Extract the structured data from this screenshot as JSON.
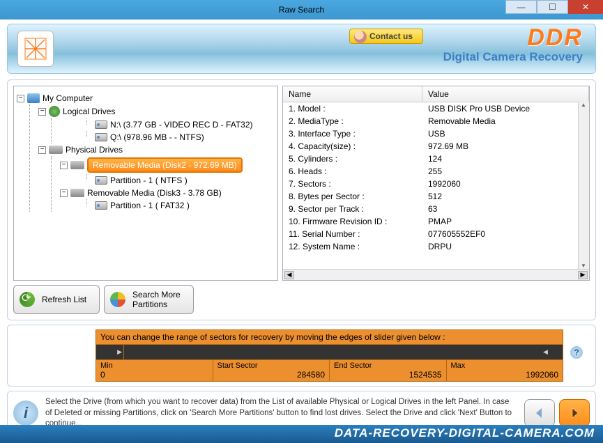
{
  "window": {
    "title": "Raw Search"
  },
  "header": {
    "contact_label": "Contact us",
    "brand_main": "DDR",
    "brand_sub": "Digital Camera Recovery"
  },
  "tree": {
    "root": "My Computer",
    "logical_label": "Logical Drives",
    "logical_drives": [
      "N:\\ (3.77 GB - VIDEO REC D - FAT32)",
      "Q:\\ (978.96 MB -  - NTFS)"
    ],
    "physical_label": "Physical Drives",
    "physical": [
      {
        "label": "Removable Media (Disk2 - 972.69 MB)",
        "selected": true,
        "partitions": [
          "Partition - 1 ( NTFS )"
        ]
      },
      {
        "label": "Removable Media (Disk3 - 3.78 GB)",
        "selected": false,
        "partitions": [
          "Partition - 1 ( FAT32 )"
        ]
      }
    ]
  },
  "props": {
    "col_name": "Name",
    "col_value": "Value",
    "rows": [
      {
        "n": "1. Model :",
        "v": "USB DISK Pro USB Device"
      },
      {
        "n": "2. MediaType :",
        "v": "Removable Media"
      },
      {
        "n": "3. Interface Type :",
        "v": "USB"
      },
      {
        "n": "4. Capacity(size) :",
        "v": "972.69 MB"
      },
      {
        "n": "5. Cylinders :",
        "v": "124"
      },
      {
        "n": "6. Heads :",
        "v": "255"
      },
      {
        "n": "7. Sectors :",
        "v": "1992060"
      },
      {
        "n": "8. Bytes per Sector :",
        "v": "512"
      },
      {
        "n": "9. Sector per Track :",
        "v": "63"
      },
      {
        "n": "10. Firmware Revision ID :",
        "v": "PMAP"
      },
      {
        "n": "11. Serial Number :",
        "v": "077605552EF0"
      },
      {
        "n": "12. System Name :",
        "v": "DRPU"
      }
    ]
  },
  "buttons": {
    "refresh": "Refresh List",
    "search_more": "Search More\nPartitions"
  },
  "sector": {
    "hint": "You can change the range of sectors for recovery by moving the edges of slider given below :",
    "min_label": "Min",
    "min_val": "0",
    "start_label": "Start Sector",
    "start_val": "284580",
    "end_label": "End Sector",
    "end_val": "1524535",
    "max_label": "Max",
    "max_val": "1992060"
  },
  "footer": {
    "text": "Select the Drive (from which you want to recover data) from the List of available Physical or Logical Drives in the left Panel. In case of Deleted or missing Partitions, click on 'Search More Partitions' button to find lost drives. Select the Drive and click 'Next' Button to continue..."
  },
  "watermark": "DATA-RECOVERY-DIGITAL-CAMERA.COM"
}
